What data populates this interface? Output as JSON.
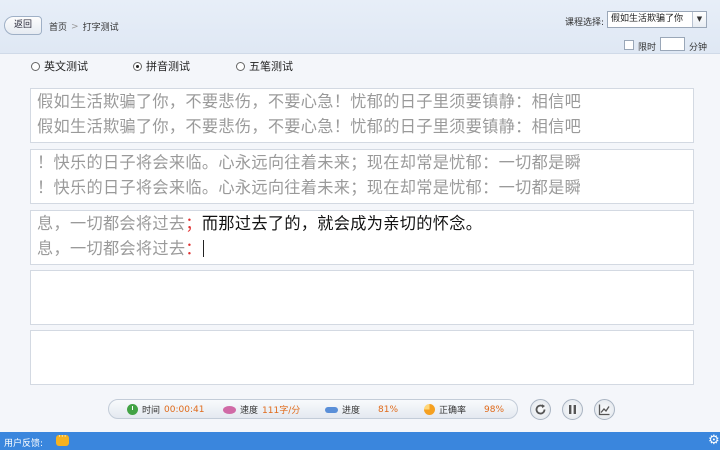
{
  "header": {
    "back_label": "返回",
    "breadcrumb": {
      "home": "首页",
      "separator": ">",
      "current": "打字测试"
    },
    "course_label": "课程选择:",
    "course_value": "假如生活欺骗了你",
    "dropdown_arrow": "▼",
    "time_limit_label": "限时",
    "minute_label": "分钟"
  },
  "modes": [
    {
      "label": "英文测试",
      "selected": false
    },
    {
      "label": "拼音测试",
      "selected": true
    },
    {
      "label": "五笔测试",
      "selected": false
    }
  ],
  "panels": [
    {
      "source": "假如生活欺骗了你，不要悲伤，不要心急！忧郁的日子里须要镇静：相信吧",
      "typed": "假如生活欺骗了你，不要悲伤，不要心急！忧郁的日子里须要镇静：相信吧"
    },
    {
      "source": "！快乐的日子将会来临。心永远向往着未来；现在却常是忧郁：一切都是瞬",
      "typed": "！快乐的日子将会来临。心永远向往着未来；现在却常是忧郁：一切都是瞬"
    },
    {
      "source_done": "息，一切都会将过去",
      "source_error": "；",
      "source_pending": "而那过去了的，就会成为亲切的怀念。",
      "typed_ok": "息，一切都会将过去",
      "typed_error": "："
    }
  ],
  "stats": {
    "time_label": "时间",
    "time_value": "00:00:41",
    "speed_label": "速度",
    "speed_value": "111字/分",
    "progress_label": "进度",
    "progress_value": "81%",
    "accuracy_label": "正确率",
    "accuracy_value": "98%"
  },
  "footer": {
    "feedback_label": "用户反馈:"
  },
  "colors": {
    "accent": "#3a86dd",
    "error": "#e03030",
    "stat_value": "#e06a1a"
  }
}
